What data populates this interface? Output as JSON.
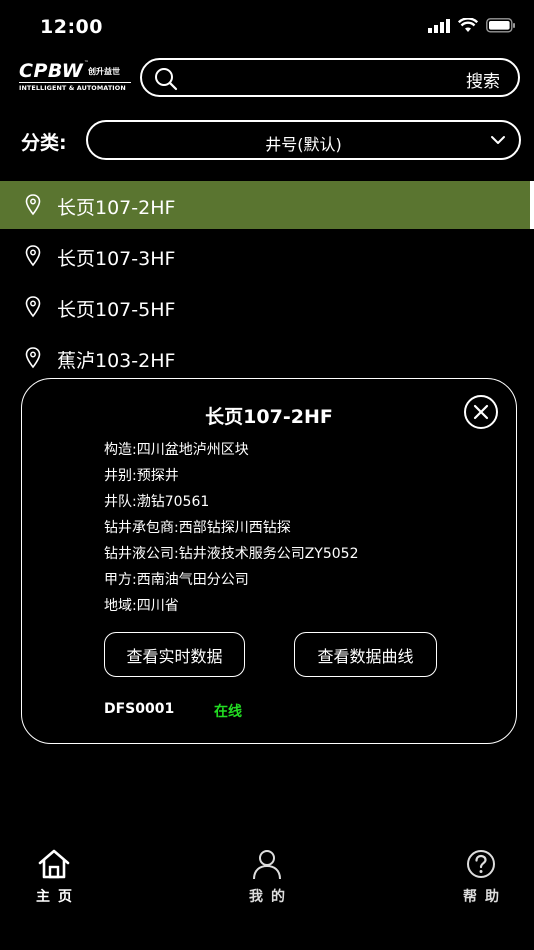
{
  "status_bar": {
    "time": "12:00"
  },
  "logo": {
    "main": "CPBW",
    "tm": "™",
    "cn": "创升益世",
    "sub": "INTELLIGENT & AUTOMATION"
  },
  "search": {
    "placeholder": "",
    "value": "",
    "button_label": "搜索"
  },
  "category": {
    "label": "分类:",
    "selected": "井号(默认)"
  },
  "wells": [
    {
      "name": "长页107-2HF",
      "active": true
    },
    {
      "name": "长页107-3HF",
      "active": false
    },
    {
      "name": "长页107-5HF",
      "active": false
    },
    {
      "name": "蕉泸103-2HF",
      "active": false
    }
  ],
  "detail": {
    "title": "长页107-2HF",
    "rows": [
      {
        "key": "构造:",
        "value": "四川盆地泸州区块"
      },
      {
        "key": "井别:",
        "value": "预探井"
      },
      {
        "key": "井队:",
        "value": "渤钻70561"
      },
      {
        "key": "钻井承包商:",
        "value": "西部钻探川西钻探"
      },
      {
        "key": "钻井液公司:",
        "value": "钻井液技术服务公司ZY5052"
      },
      {
        "key": "甲方:",
        "value": "西南油气田分公司"
      },
      {
        "key": "地域:",
        "value": "四川省"
      }
    ],
    "realtime_button": "查看实时数据",
    "curve_button": "查看数据曲线",
    "device_id": "DFS0001",
    "device_status": "在线",
    "status_color": "#22dd22"
  },
  "tabs": [
    {
      "label": "主页",
      "icon": "home-icon"
    },
    {
      "label": "我的",
      "icon": "user-icon"
    },
    {
      "label": "帮助",
      "icon": "help-icon"
    }
  ],
  "colors": {
    "accent": "#5a7530",
    "background": "#000000"
  }
}
